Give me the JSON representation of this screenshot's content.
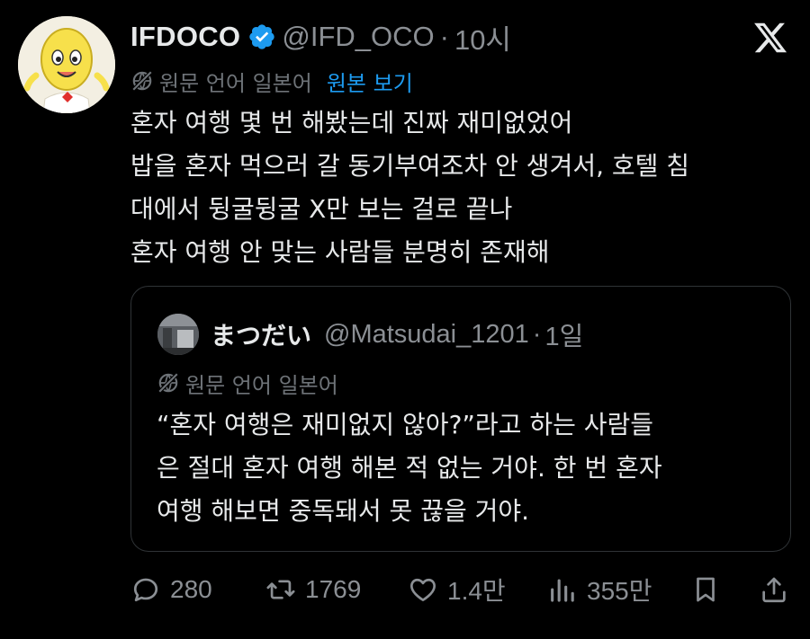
{
  "tweet": {
    "display_name": "IFDOCO",
    "handle": "@IFD_OCO",
    "separator": "·",
    "time": "10시",
    "translation": {
      "label": "원문 언어 일본어",
      "show_original": "원본 보기"
    },
    "lines": [
      "혼자 여행 몇 번 해봤는데 진짜 재미없었어",
      "밥을 혼자 먹으러 갈 동기부여조차 안 생겨서, 호텔 침",
      "대에서 뒹굴뒹굴 X만 보는 걸로 끝나",
      "혼자 여행 안 맞는 사람들 분명히 존재해"
    ]
  },
  "quote": {
    "display_name": "まつだい",
    "handle": "@Matsudai_1201",
    "separator": "·",
    "time": "1일",
    "translation": {
      "label": "원문 언어 일본어"
    },
    "lines": [
      "“혼자 여행은 재미없지 않아?”라고 하는 사람들",
      "은 절대 혼자 여행 해본 적 없는 거야. 한 번 혼자",
      "여행 해보면 중독돼서 못 끊을 거야."
    ]
  },
  "actions": {
    "replies": "280",
    "reposts": "1769",
    "likes": "1.4만",
    "views": "355만"
  },
  "icons": {
    "verified": "verified-badge-icon",
    "logo": "x-logo-icon",
    "translate": "globe-slash-icon",
    "reply": "reply-icon",
    "repost": "repost-icon",
    "like": "heart-icon",
    "views": "views-icon",
    "bookmark": "bookmark-icon",
    "share": "share-icon"
  },
  "colors": {
    "background": "#000000",
    "text": "#e7e9ea",
    "muted": "#8b8f94",
    "link": "#1d9bf0",
    "verified": "#1d9bf0"
  }
}
